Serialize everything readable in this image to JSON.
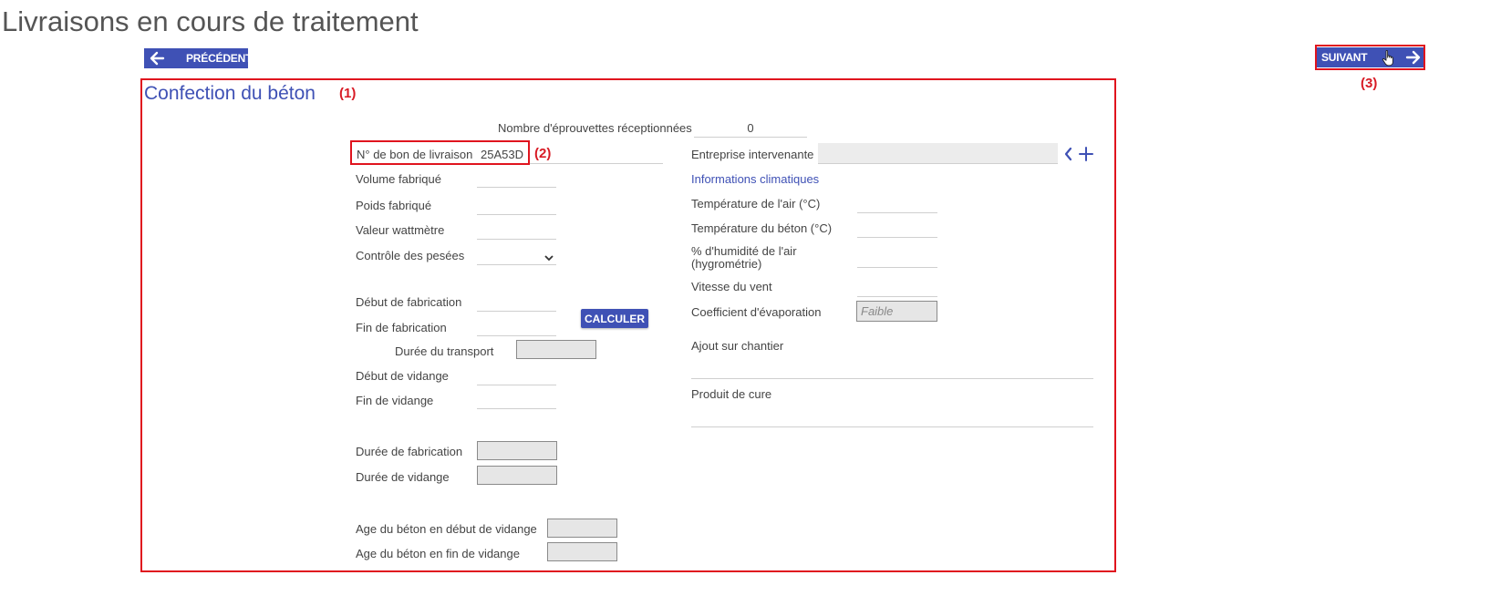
{
  "page": {
    "title": "Livraisons en cours de traitement"
  },
  "nav": {
    "prev_label": "PRÉCÉDENT",
    "next_label": "SUIVANT"
  },
  "annotations": {
    "a1": "(1)",
    "a2": "(2)",
    "a3": "(3)"
  },
  "section": {
    "title": "Confection du béton"
  },
  "form": {
    "nb_eprouvettes": {
      "label": "Nombre d'éprouvettes réceptionnées",
      "value": "0"
    },
    "bon_livraison": {
      "label": "N° de bon de livraison",
      "value": "25A53D"
    },
    "volume": {
      "label": "Volume fabriqué"
    },
    "poids": {
      "label": "Poids fabriqué"
    },
    "wattmetre": {
      "label": "Valeur wattmètre"
    },
    "controle_pesees": {
      "label": "Contrôle des pesées"
    },
    "debut_fabrication": {
      "label": "Début de fabrication"
    },
    "fin_fabrication": {
      "label": "Fin de fabrication"
    },
    "calculer": {
      "label": "CALCULER"
    },
    "duree_transport": {
      "label": "Durée du transport"
    },
    "debut_vidange": {
      "label": "Début de vidange"
    },
    "fin_vidange": {
      "label": "Fin de vidange"
    },
    "duree_fabrication": {
      "label": "Durée de fabrication"
    },
    "duree_vidange": {
      "label": "Durée de vidange"
    },
    "age_debut": {
      "label": "Age du béton en début de vidange"
    },
    "age_fin": {
      "label": "Age du béton en fin de vidange"
    },
    "entreprise": {
      "label": "Entreprise intervenante"
    },
    "climat_link": "Informations climatiques",
    "temp_air": {
      "label": "Température de l'air (°C)"
    },
    "temp_beton": {
      "label": "Température du béton (°C)"
    },
    "humidite": {
      "label_line1": "% d'humidité de l'air",
      "label_line2": "(hygrométrie)"
    },
    "vent": {
      "label": "Vitesse du vent"
    },
    "evaporation": {
      "label": "Coefficient d'évaporation",
      "placeholder": "Faible"
    },
    "ajout": {
      "label": "Ajout sur chantier"
    },
    "cure": {
      "label": "Produit de cure"
    }
  },
  "colors": {
    "accent": "#3f51b5",
    "annotation_red": "#e0141e"
  },
  "icons": [
    "arrow-left-icon",
    "arrow-right-icon",
    "hand-cursor-icon",
    "chevron-down-icon",
    "chevron-left-icon",
    "plus-icon"
  ]
}
